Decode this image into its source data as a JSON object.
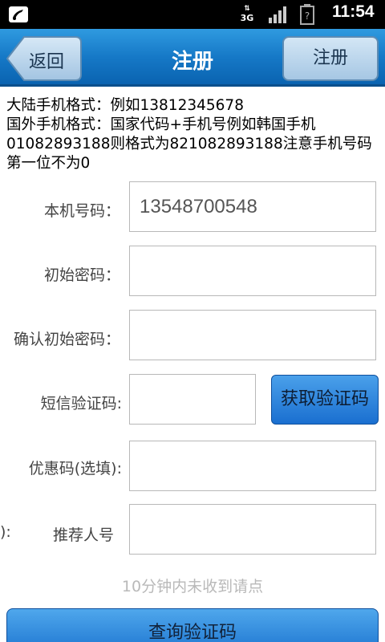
{
  "status_bar": {
    "time": "11:54",
    "data_label": "3G",
    "icons": [
      "notification-icon",
      "data-transfer-icon",
      "signal-icon",
      "battery-unknown-icon"
    ]
  },
  "header": {
    "back_label": "返回",
    "title": "注册",
    "register_label": "注册"
  },
  "info": {
    "line1": "大陆手机格式：例如13812345678",
    "line2": "国外手机格式：国家代码+手机号例如韩国手机01082893188则格式为821082893188注意手机号码第一位不为0"
  },
  "form": {
    "phone_label": "本机号码：",
    "phone_value": "13548700548",
    "password_label": "初始密码：",
    "confirm_label": "确认初始密码：",
    "sms_label": "短信验证码:",
    "sms_button": "获取验证码",
    "coupon_label": "优惠码(选填):",
    "referrer_label": "推荐人号",
    "referrer_label_left": "):"
  },
  "note": "10分钟内未收到请点",
  "bottom_button": "查询验证码",
  "colors": {
    "header_blue": "#1679c7",
    "button_blue": "#2a84dc",
    "note_gray": "#b9b9b9"
  }
}
